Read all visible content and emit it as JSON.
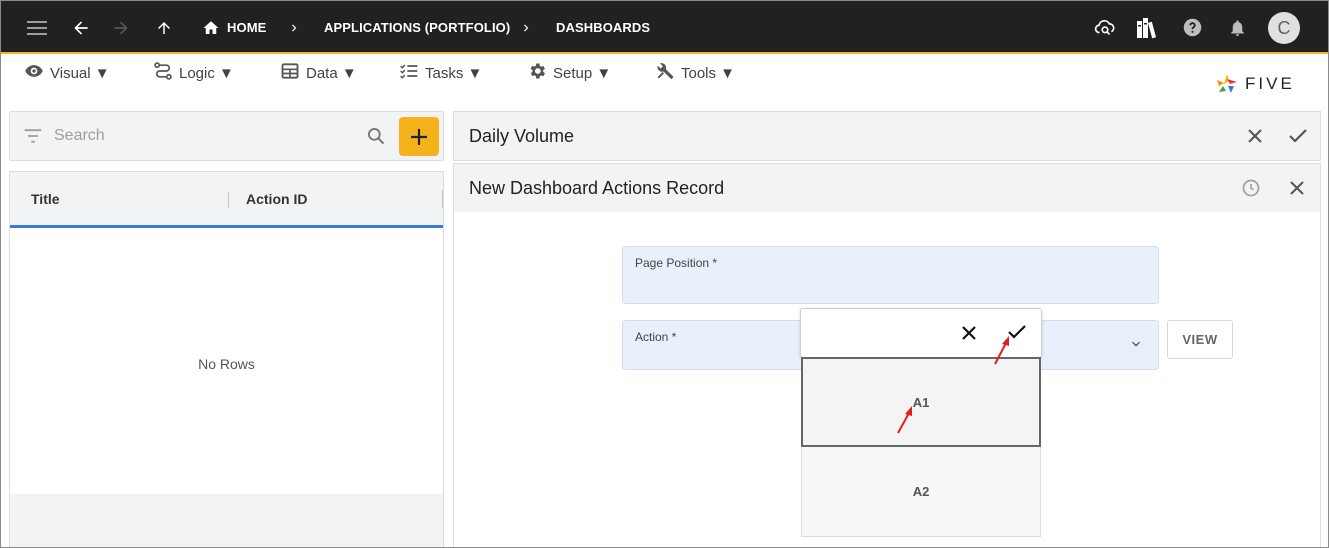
{
  "topbar": {
    "breadcrumbs": [
      "HOME",
      "APPLICATIONS (PORTFOLIO)",
      "DASHBOARDS"
    ],
    "avatar_initial": "C"
  },
  "menu": {
    "items": [
      {
        "label": "Visual ▼",
        "icon": "eye-icon"
      },
      {
        "label": "Logic ▼",
        "icon": "logic-icon"
      },
      {
        "label": "Data ▼",
        "icon": "table-icon"
      },
      {
        "label": "Tasks ▼",
        "icon": "checklist-icon"
      },
      {
        "label": "Setup ▼",
        "icon": "gear-icon"
      },
      {
        "label": "Tools ▼",
        "icon": "tools-icon"
      }
    ],
    "logo_text": "FIVE"
  },
  "left": {
    "search_placeholder": "Search",
    "columns": [
      "Title",
      "Action ID"
    ],
    "empty_text": "No Rows"
  },
  "panel1": {
    "title": "Daily Volume"
  },
  "panel2": {
    "title": "New Dashboard Actions Record"
  },
  "form": {
    "page_position_label": "Page Position *",
    "action_label": "Action *",
    "view_button": "VIEW"
  },
  "dropdown": {
    "options": [
      "A1",
      "A2"
    ],
    "selected": "A1"
  },
  "colors": {
    "accent": "#f5b21a",
    "topbar": "#212121",
    "header_underline": "#3a7bd5",
    "annotation": "#e02020"
  }
}
